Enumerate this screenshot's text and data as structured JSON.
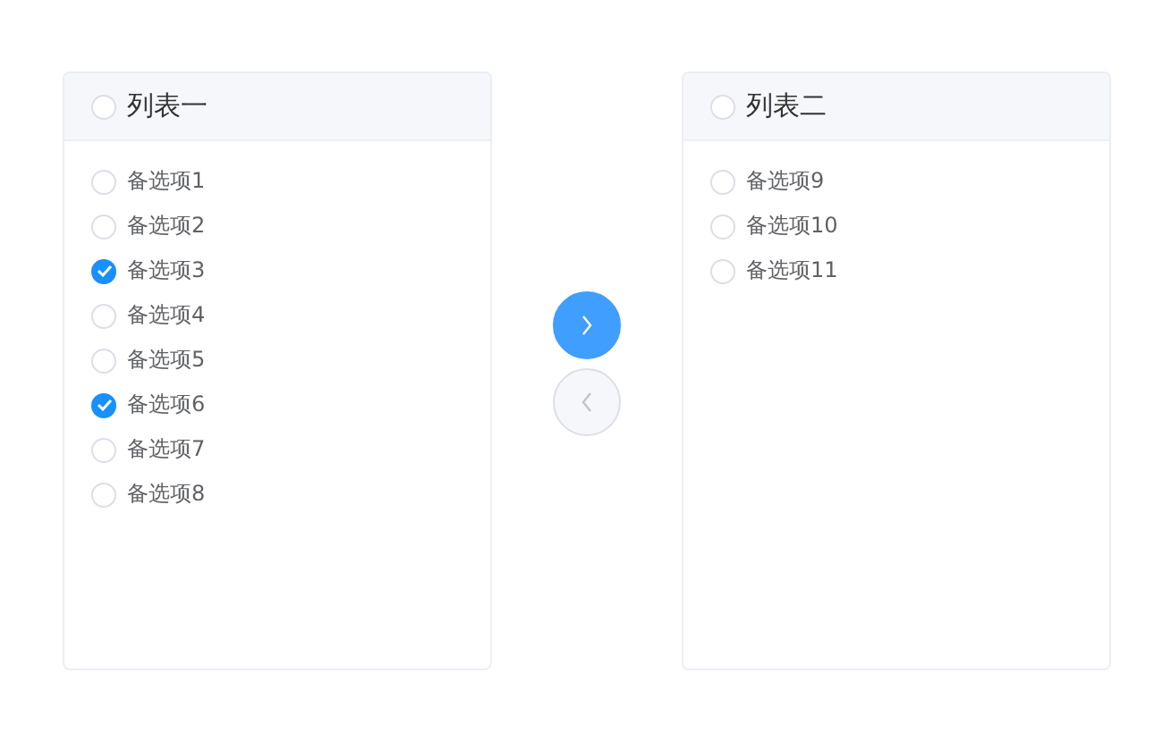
{
  "panels": [
    {
      "title": "列表一",
      "checked": false,
      "items": [
        {
          "label": "备选项1",
          "checked": false
        },
        {
          "label": "备选项2",
          "checked": false
        },
        {
          "label": "备选项3",
          "checked": true
        },
        {
          "label": "备选项4",
          "checked": false
        },
        {
          "label": "备选项5",
          "checked": false
        },
        {
          "label": "备选项6",
          "checked": true
        },
        {
          "label": "备选项7",
          "checked": false
        },
        {
          "label": "备选项8",
          "checked": false
        }
      ]
    },
    {
      "title": "列表二",
      "checked": false,
      "items": [
        {
          "label": "备选项9",
          "checked": false
        },
        {
          "label": "备选项10",
          "checked": false
        },
        {
          "label": "备选项11",
          "checked": false
        }
      ]
    }
  ],
  "buttons": [
    {
      "kind": "right",
      "disabled": false
    },
    {
      "kind": "left",
      "disabled": true
    }
  ]
}
